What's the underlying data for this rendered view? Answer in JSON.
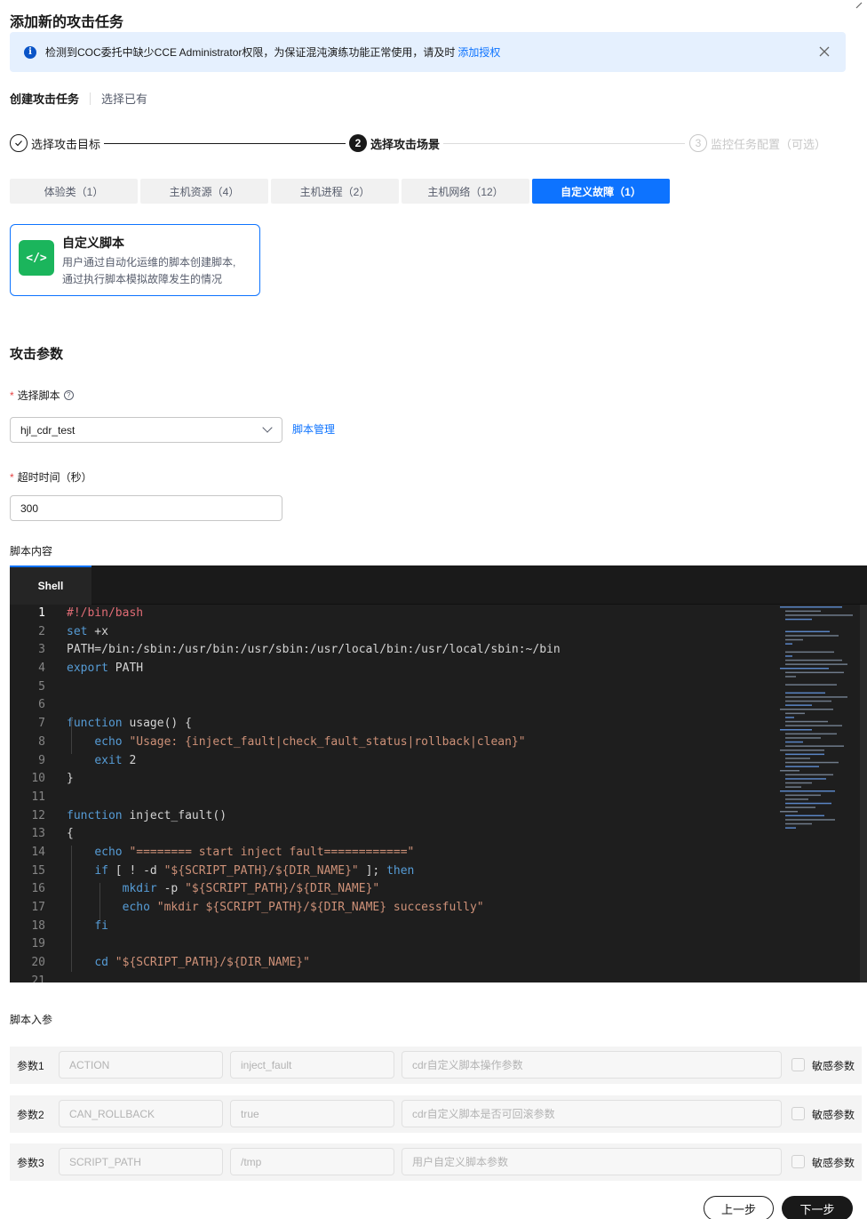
{
  "dialog": {
    "title": "添加新的攻击任务"
  },
  "alert": {
    "message": "检测到COC委托中缺少CCE Administrator权限，为保证混沌演练功能正常使用，请及时",
    "link": "添加授权"
  },
  "mode_tabs": {
    "create": "创建攻击任务",
    "select": "选择已有"
  },
  "steps": [
    {
      "num": "✓",
      "label": "选择攻击目标"
    },
    {
      "num": "2",
      "label": "选择攻击场景"
    },
    {
      "num": "3",
      "label": "监控任务配置（可选）"
    }
  ],
  "categories": [
    {
      "label": "体验类（1）"
    },
    {
      "label": "主机资源（4）"
    },
    {
      "label": "主机进程（2）"
    },
    {
      "label": "主机网络（12）"
    },
    {
      "label": "自定义故障（1）"
    }
  ],
  "script_card": {
    "icon": "</>",
    "title": "自定义脚本",
    "desc_line1": "用户通过自动化运维的脚本创建脚本,",
    "desc_line2": "通过执行脚本模拟故障发生的情况"
  },
  "attack_params": {
    "section_title": "攻击参数",
    "required_mark": "*",
    "script_label": "选择脚本",
    "help_icon": "?",
    "script_value": "hjl_cdr_test",
    "script_mgmt": "脚本管理",
    "timeout_label": "超时时间（秒）",
    "timeout_value": "300",
    "content_label": "脚本内容"
  },
  "editor": {
    "tab": "Shell",
    "lines": [
      {
        "n": "1",
        "t": "#!/bin/bash"
      },
      {
        "n": "2",
        "t": "set +x"
      },
      {
        "n": "3",
        "t": "PATH=/bin:/sbin:/usr/bin:/usr/sbin:/usr/local/bin:/usr/local/sbin:~/bin"
      },
      {
        "n": "4",
        "t": "export PATH"
      },
      {
        "n": "5",
        "t": ""
      },
      {
        "n": "6",
        "t": ""
      },
      {
        "n": "7",
        "t": "function usage() {"
      },
      {
        "n": "8",
        "t": "    echo \"Usage: {inject_fault|check_fault_status|rollback|clean}\""
      },
      {
        "n": "9",
        "t": "    exit 2"
      },
      {
        "n": "10",
        "t": "}"
      },
      {
        "n": "11",
        "t": ""
      },
      {
        "n": "12",
        "t": "function inject_fault()"
      },
      {
        "n": "13",
        "t": "{"
      },
      {
        "n": "14",
        "t": "    echo \"======== start inject fault============\""
      },
      {
        "n": "15",
        "t": "    if [ ! -d \"${SCRIPT_PATH}/${DIR_NAME}\" ]; then"
      },
      {
        "n": "16",
        "t": "        mkdir -p \"${SCRIPT_PATH}/${DIR_NAME}\""
      },
      {
        "n": "17",
        "t": "        echo \"mkdir ${SCRIPT_PATH}/${DIR_NAME} successfully\""
      },
      {
        "n": "18",
        "t": "    fi"
      },
      {
        "n": "19",
        "t": ""
      },
      {
        "n": "20",
        "t": "    cd \"${SCRIPT_PATH}/${DIR_NAME}\""
      },
      {
        "n": "21",
        "t": ""
      }
    ]
  },
  "script_params": {
    "label": "脚本入参",
    "sensitive_label": "敏感参数",
    "rows": [
      {
        "name": "参数1",
        "key": "ACTION",
        "value": "inject_fault",
        "desc": "cdr自定义脚本操作参数"
      },
      {
        "name": "参数2",
        "key": "CAN_ROLLBACK",
        "value": "true",
        "desc": "cdr自定义脚本是否可回滚参数"
      },
      {
        "name": "参数3",
        "key": "SCRIPT_PATH",
        "value": "/tmp",
        "desc": "用户自定义脚本参数"
      }
    ]
  },
  "footer": {
    "prev": "上一步",
    "next": "下一步"
  },
  "colors": {
    "primary": "#0d73ff",
    "editor_bg": "#1e1e1e",
    "required": "#e54545",
    "card_icon": "#1bb55c"
  }
}
